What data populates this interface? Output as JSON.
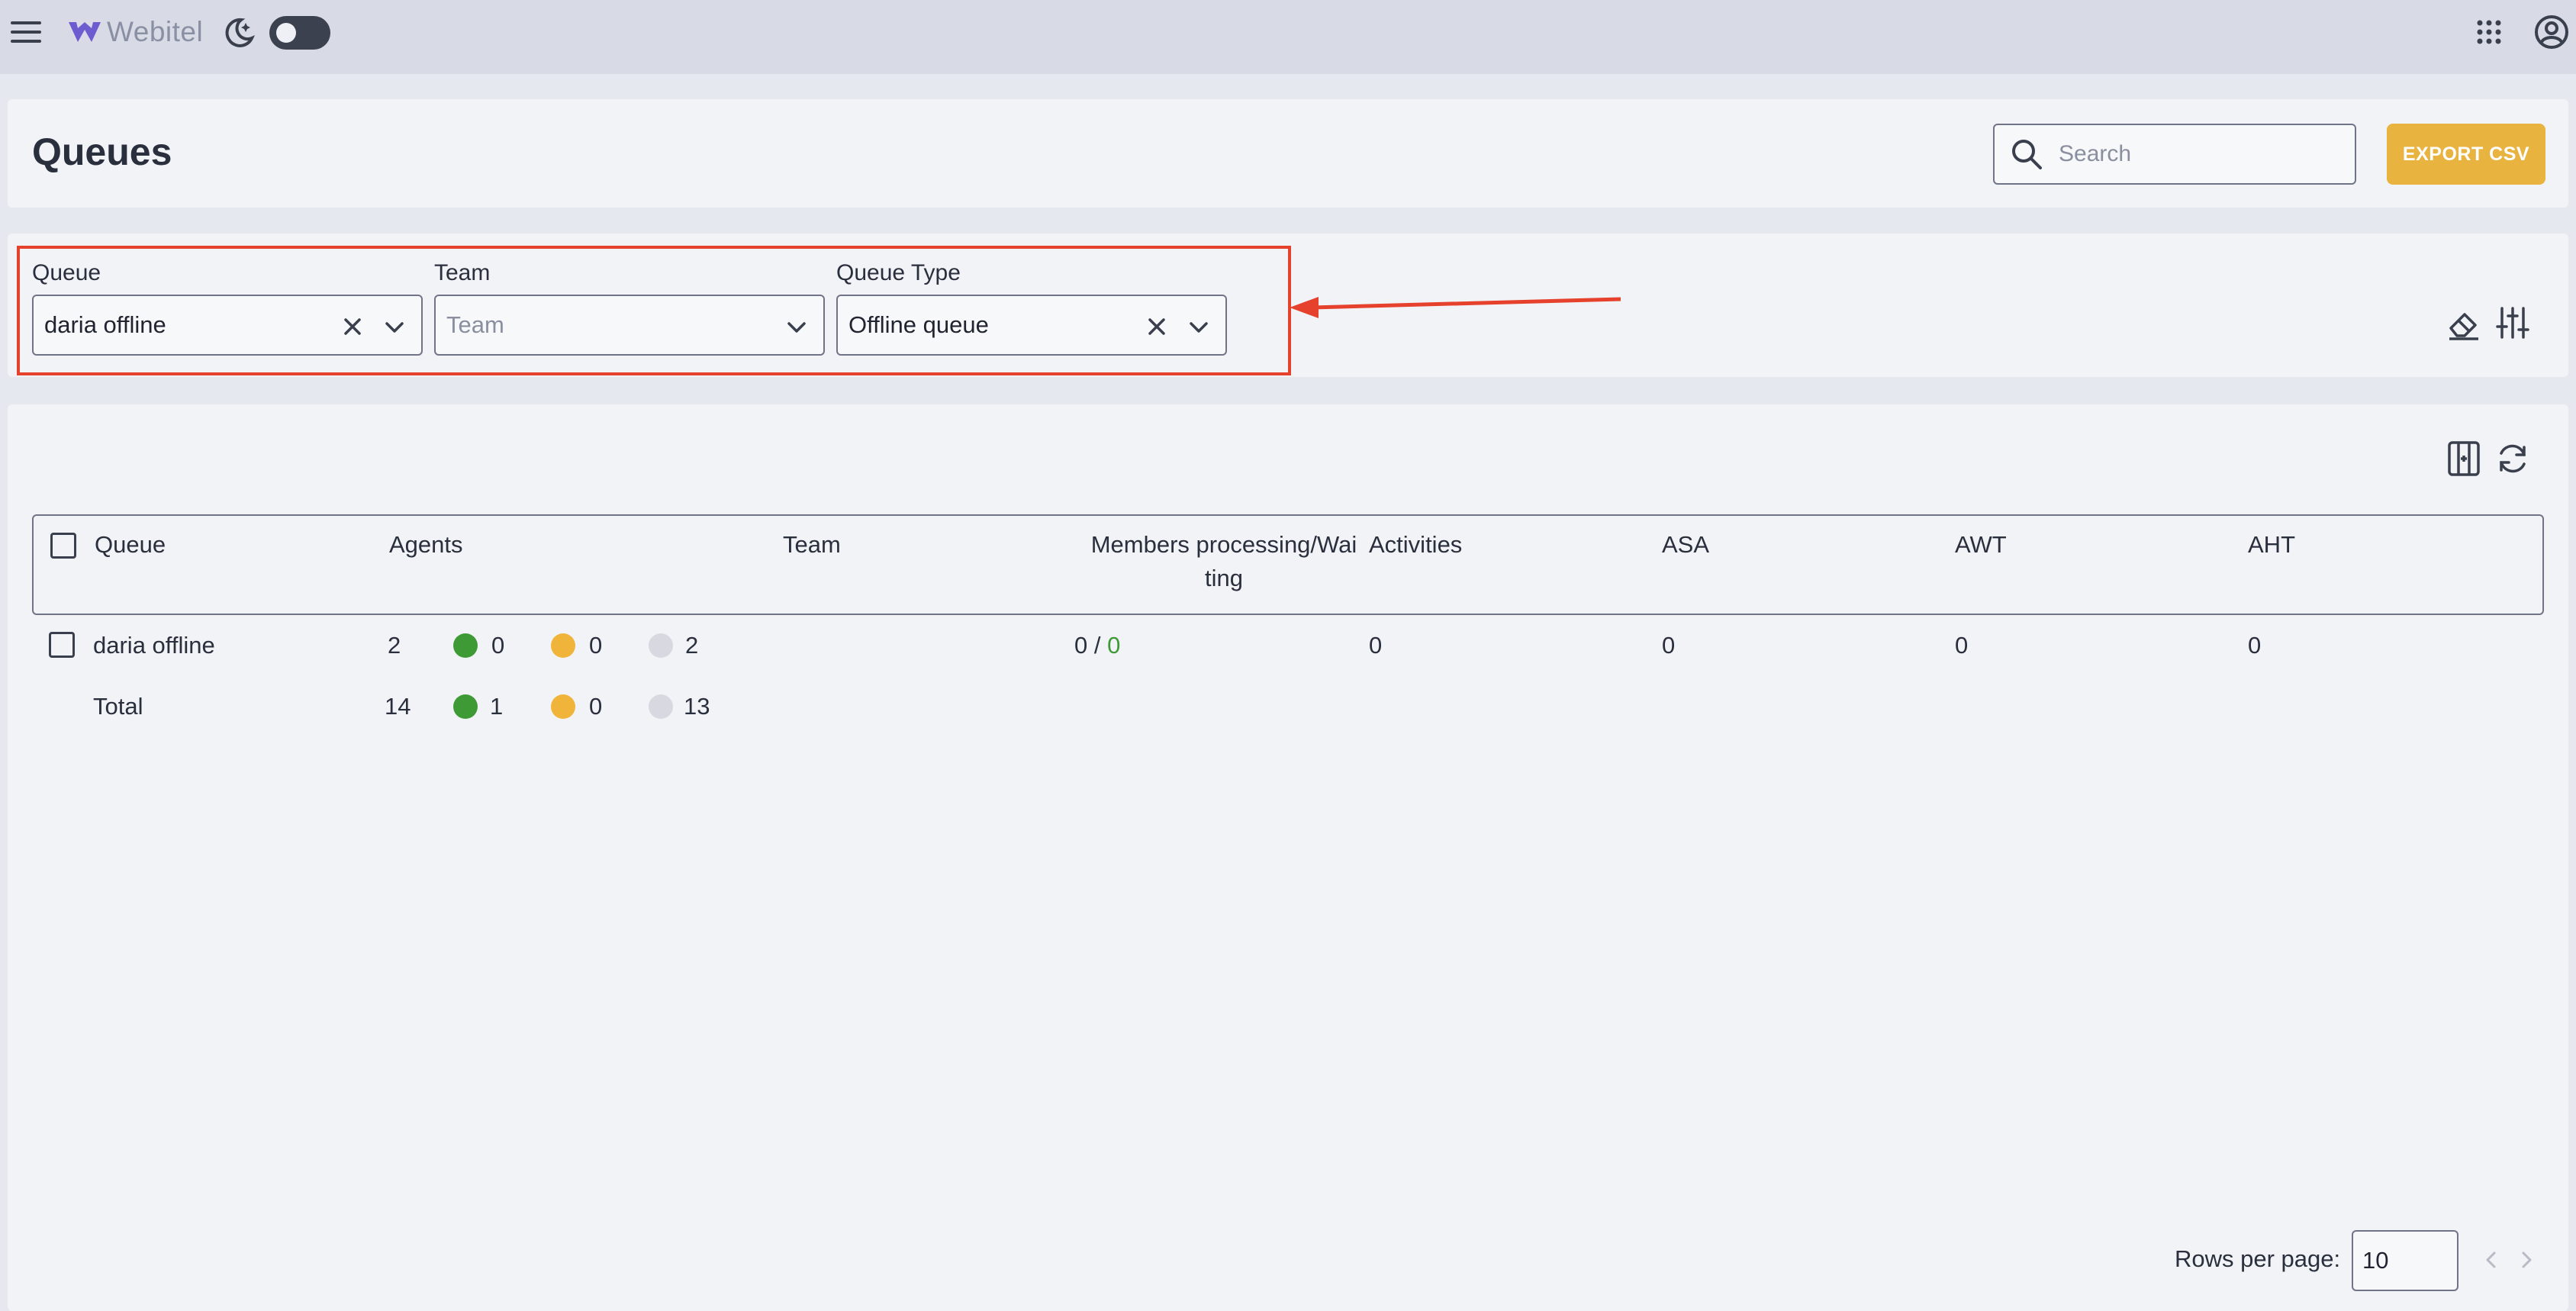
{
  "app": {
    "brand": "Webitel"
  },
  "header": {
    "title": "Queues",
    "search_placeholder": "Search",
    "export_label": "EXPORT CSV"
  },
  "filters": {
    "queue": {
      "label": "Queue",
      "value": "daria offline"
    },
    "team": {
      "label": "Team",
      "placeholder": "Team"
    },
    "queue_type": {
      "label": "Queue Type",
      "value": "Offline queue"
    }
  },
  "table": {
    "columns": [
      "Queue",
      "Agents",
      "Team",
      "Members processing/Wai",
      "ting",
      "Activities",
      "ASA",
      "AWT",
      "AHT"
    ],
    "rows": [
      {
        "queue": "daria offline",
        "agents_total": "2",
        "agents_online": "0",
        "agents_pause": "0",
        "agents_offline": "2",
        "team": "",
        "processing": "0 /",
        "waiting": "0",
        "activities": "0",
        "asa": "0",
        "awt": "0",
        "aht": "0"
      }
    ],
    "total": {
      "label": "Total",
      "agents_total": "14",
      "agents_online": "1",
      "agents_pause": "0",
      "agents_offline": "13"
    }
  },
  "pagination": {
    "rows_per_page_label": "Rows per page:",
    "rows_per_page_value": "10"
  },
  "colors": {
    "accent": "#e9b33f",
    "highlight": "#e5412c",
    "online": "#3e9a35",
    "pause": "#f0b43a",
    "offline": "#d8d9e0"
  }
}
